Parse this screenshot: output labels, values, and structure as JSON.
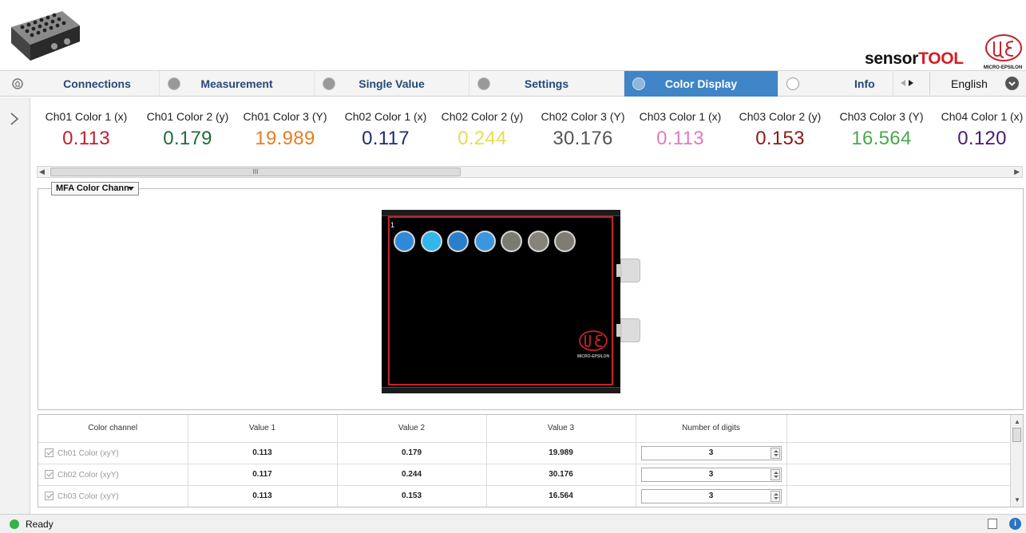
{
  "header": {
    "brand_part1": "sensor",
    "brand_part2": "TOOL",
    "logo_caption": "MICRO-EPSILON"
  },
  "tabs": [
    {
      "label": "Connections",
      "icon": "connections-icon"
    },
    {
      "label": "Measurement",
      "icon": "waveform-icon"
    },
    {
      "label": "Single Value",
      "icon": "single-value-icon"
    },
    {
      "label": "Settings",
      "icon": "settings-icon"
    },
    {
      "label": "Color Display",
      "icon": "color-display-icon",
      "active": true
    },
    {
      "label": "Info",
      "icon": "info-icon"
    }
  ],
  "language": {
    "selected": "English"
  },
  "readouts": [
    {
      "label": "Ch01 Color 1 (x)",
      "value": "0.113",
      "color": "#c0202f"
    },
    {
      "label": "Ch01 Color 2 (y)",
      "value": "0.179",
      "color": "#1f6b3a"
    },
    {
      "label": "Ch01 Color 3 (Y)",
      "value": "19.989",
      "color": "#e87e1e"
    },
    {
      "label": "Ch02 Color 1 (x)",
      "value": "0.117",
      "color": "#1d2a7a"
    },
    {
      "label": "Ch02 Color 2 (y)",
      "value": "0.244",
      "color": "#e6dc55"
    },
    {
      "label": "Ch02 Color 3 (Y)",
      "value": "30.176",
      "color": "#555555"
    },
    {
      "label": "Ch03 Color 1 (x)",
      "value": "0.113",
      "color": "#e07bc0"
    },
    {
      "label": "Ch03 Color 2 (y)",
      "value": "0.153",
      "color": "#8a1a1a"
    },
    {
      "label": "Ch03 Color 3 (Y)",
      "value": "16.564",
      "color": "#4aa84a"
    },
    {
      "label": "Ch04 Color 1 (x)",
      "value": "0.120",
      "color": "#4b1a6e"
    }
  ],
  "viewer": {
    "channel_select": "MFA Color Chann",
    "channel_number": "1",
    "sensor_dots": [
      "#2e8ad8",
      "#33b6ea",
      "#2a7fcd",
      "#3a96de",
      "#7b7b74",
      "#85837a",
      "#7e7c73"
    ]
  },
  "table": {
    "headers": [
      "Color channel",
      "Value 1",
      "Value 2",
      "Value 3",
      "Number of digits"
    ],
    "rows": [
      {
        "channel": "Ch01 Color (xyY)",
        "v1": "0.113",
        "v2": "0.179",
        "v3": "19.989",
        "digits": "3"
      },
      {
        "channel": "Ch02 Color (xyY)",
        "v1": "0.117",
        "v2": "0.244",
        "v3": "30.176",
        "digits": "3"
      },
      {
        "channel": "Ch03 Color (xyY)",
        "v1": "0.113",
        "v2": "0.153",
        "v3": "16.564",
        "digits": "3"
      }
    ]
  },
  "status": {
    "text": "Ready"
  },
  "colors": {
    "accent": "#3f85c7",
    "brand_red": "#d31f26",
    "ok": "#37b24a"
  }
}
